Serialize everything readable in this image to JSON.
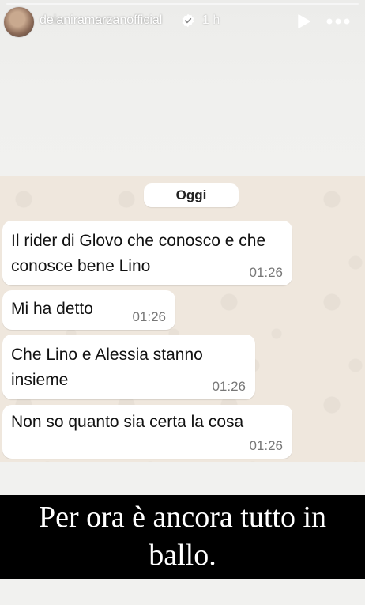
{
  "header": {
    "username": "deianiramarzanofficial",
    "time_ago": "1 h",
    "icons": [
      "avatar",
      "verified-badge-icon",
      "play-icon",
      "more-icon"
    ]
  },
  "chat": {
    "date_label": "Oggi",
    "messages": [
      {
        "text": "Il rider di Glovo che conosco e che conosce bene Lino",
        "time": "01:26"
      },
      {
        "text": "Mi ha detto",
        "time": "01:26"
      },
      {
        "text": "Che Lino e Alessia stanno insieme",
        "time": "01:26"
      },
      {
        "text": "Non so quanto sia certa la cosa",
        "time": "01:26"
      }
    ]
  },
  "caption": {
    "line1": "Per ora è ancora tutto in",
    "line2": "ballo."
  },
  "colors": {
    "chat_background": "#efe7dd",
    "bubble": "#ffffff",
    "caption_background": "#000000",
    "caption_text": "#ffffff"
  }
}
